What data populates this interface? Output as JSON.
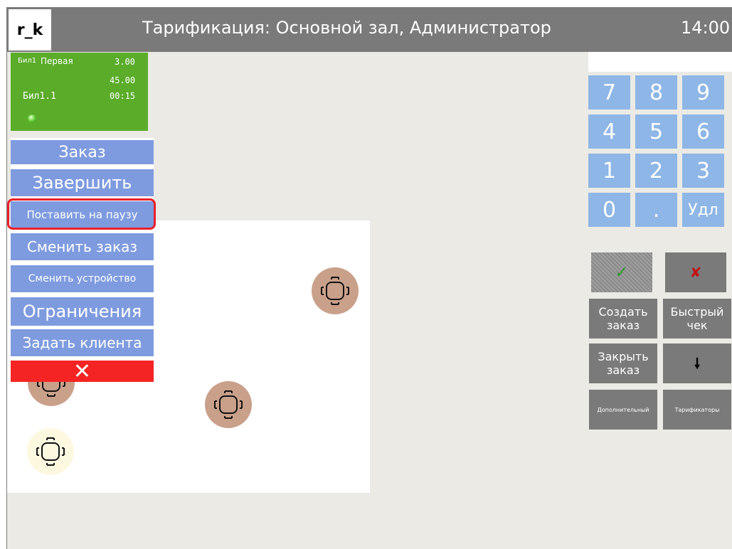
{
  "header": {
    "logo": "r_k",
    "title": "Тарификация: Основной зал, Администратор",
    "clock": "14:00"
  },
  "device_card": {
    "code": "Бил1",
    "name": "Первая",
    "price": "3.00",
    "amount": "45.00",
    "device_id": "Бил1.1",
    "elapsed": "00:15",
    "status_color": "#5aac29"
  },
  "menu": {
    "items": [
      {
        "label": "Заказ"
      },
      {
        "label": "Завершить"
      },
      {
        "label": "Поставить на паузу"
      },
      {
        "label": "Сменить заказ"
      },
      {
        "label": "Сменить устройство"
      },
      {
        "label": "Ограничения"
      },
      {
        "label": "Задать клиента"
      }
    ],
    "close_icon": "close-icon",
    "close_glyph": "✕",
    "highlighted_item": "Поставить на паузу"
  },
  "hall": {
    "tables": [
      {
        "state": "busy"
      },
      {
        "state": "busy"
      },
      {
        "state": "busy"
      },
      {
        "state": "free"
      }
    ]
  },
  "keypad": {
    "keys": [
      "7",
      "8",
      "9",
      "4",
      "5",
      "6",
      "1",
      "2",
      "3",
      "0",
      ".",
      "Удл"
    ]
  },
  "actions": {
    "confirm_icon": "check-icon",
    "confirm_glyph": "✓",
    "cancel_icon": "cross-icon",
    "cancel_glyph": "✘",
    "create_order": "Создать заказ",
    "quick_check": "Быстрый чек",
    "close_order": "Закрыть заказ",
    "down_icon": "arrow-down-icon",
    "down_glyph": "🠗",
    "additional": "Дополнительный",
    "tariffs": "Тарификаторы"
  },
  "colors": {
    "menu_button": "#7f9bdf",
    "close_button": "#f42424",
    "keypad": "#8eb6e6",
    "busy_table": "#c9a08a",
    "free_table": "#fdf9e1",
    "highlight": "#e8202a"
  }
}
